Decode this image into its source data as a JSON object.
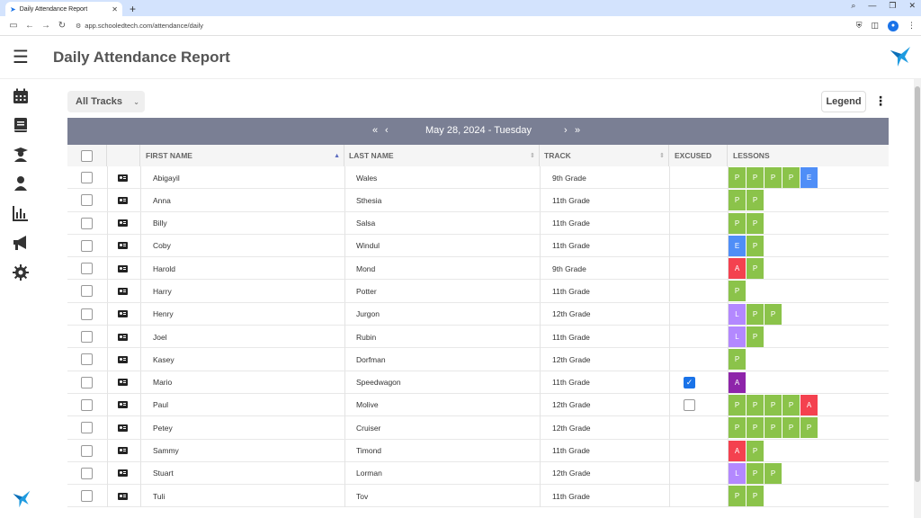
{
  "browser": {
    "tab_title": "Daily Attendance Report",
    "url": "app.schooledtech.com/attendance/daily"
  },
  "header": {
    "title": "Daily Attendance Report"
  },
  "toolbar": {
    "tracks_label": "All Tracks",
    "legend_label": "Legend"
  },
  "datebar": {
    "date_label": "May 28, 2024 - Tuesday"
  },
  "table": {
    "headers": {
      "first_name": "FIRST NAME",
      "last_name": "LAST NAME",
      "track": "TRACK",
      "excused": "EXCUSED",
      "lessons": "LESSONS"
    },
    "rows": [
      {
        "first": "Abigayil",
        "last": "Wales",
        "track": "9th Grade",
        "excused": null,
        "lessons": [
          "P",
          "P",
          "P",
          "P",
          "E"
        ]
      },
      {
        "first": "Anna",
        "last": "Sthesia",
        "track": "11th Grade",
        "excused": null,
        "lessons": [
          "P",
          "P"
        ]
      },
      {
        "first": "Billy",
        "last": "Salsa",
        "track": "11th Grade",
        "excused": null,
        "lessons": [
          "P",
          "P"
        ]
      },
      {
        "first": "Coby",
        "last": "Windul",
        "track": "11th Grade",
        "excused": null,
        "lessons": [
          "E",
          "P"
        ]
      },
      {
        "first": "Harold",
        "last": "Mond",
        "track": "9th Grade",
        "excused": null,
        "lessons": [
          "A",
          "P"
        ]
      },
      {
        "first": "Harry",
        "last": "Potter",
        "track": "11th Grade",
        "excused": null,
        "lessons": [
          "P"
        ]
      },
      {
        "first": "Henry",
        "last": "Jurgon",
        "track": "12th Grade",
        "excused": null,
        "lessons": [
          "L",
          "P",
          "P"
        ]
      },
      {
        "first": "Joel",
        "last": "Rubin",
        "track": "11th Grade",
        "excused": null,
        "lessons": [
          "L",
          "P"
        ]
      },
      {
        "first": "Kasey",
        "last": "Dorfman",
        "track": "12th Grade",
        "excused": null,
        "lessons": [
          "P"
        ]
      },
      {
        "first": "Mario",
        "last": "Speedwagon",
        "track": "11th Grade",
        "excused": true,
        "lessons": [
          "A*"
        ]
      },
      {
        "first": "Paul",
        "last": "Molive",
        "track": "12th Grade",
        "excused": false,
        "lessons": [
          "P",
          "P",
          "P",
          "P",
          "A"
        ]
      },
      {
        "first": "Petey",
        "last": "Cruiser",
        "track": "12th Grade",
        "excused": null,
        "lessons": [
          "P",
          "P",
          "P",
          "P",
          "P"
        ]
      },
      {
        "first": "Sammy",
        "last": "Timond",
        "track": "11th Grade",
        "excused": null,
        "lessons": [
          "A",
          "P"
        ]
      },
      {
        "first": "Stuart",
        "last": "Lorman",
        "track": "12th Grade",
        "excused": null,
        "lessons": [
          "L",
          "P",
          "P"
        ]
      },
      {
        "first": "Tuli",
        "last": "Tov",
        "track": "11th Grade",
        "excused": null,
        "lessons": [
          "P",
          "P"
        ]
      }
    ]
  },
  "lesson_colors": {
    "P": "#8bc34a",
    "E": "#4f8ef7",
    "A": "#f4414f",
    "L": "#b388ff",
    "A*": "#8e24aa"
  },
  "colors": {
    "header_bar": "#7a7f94",
    "accent": "#1a73e8"
  }
}
